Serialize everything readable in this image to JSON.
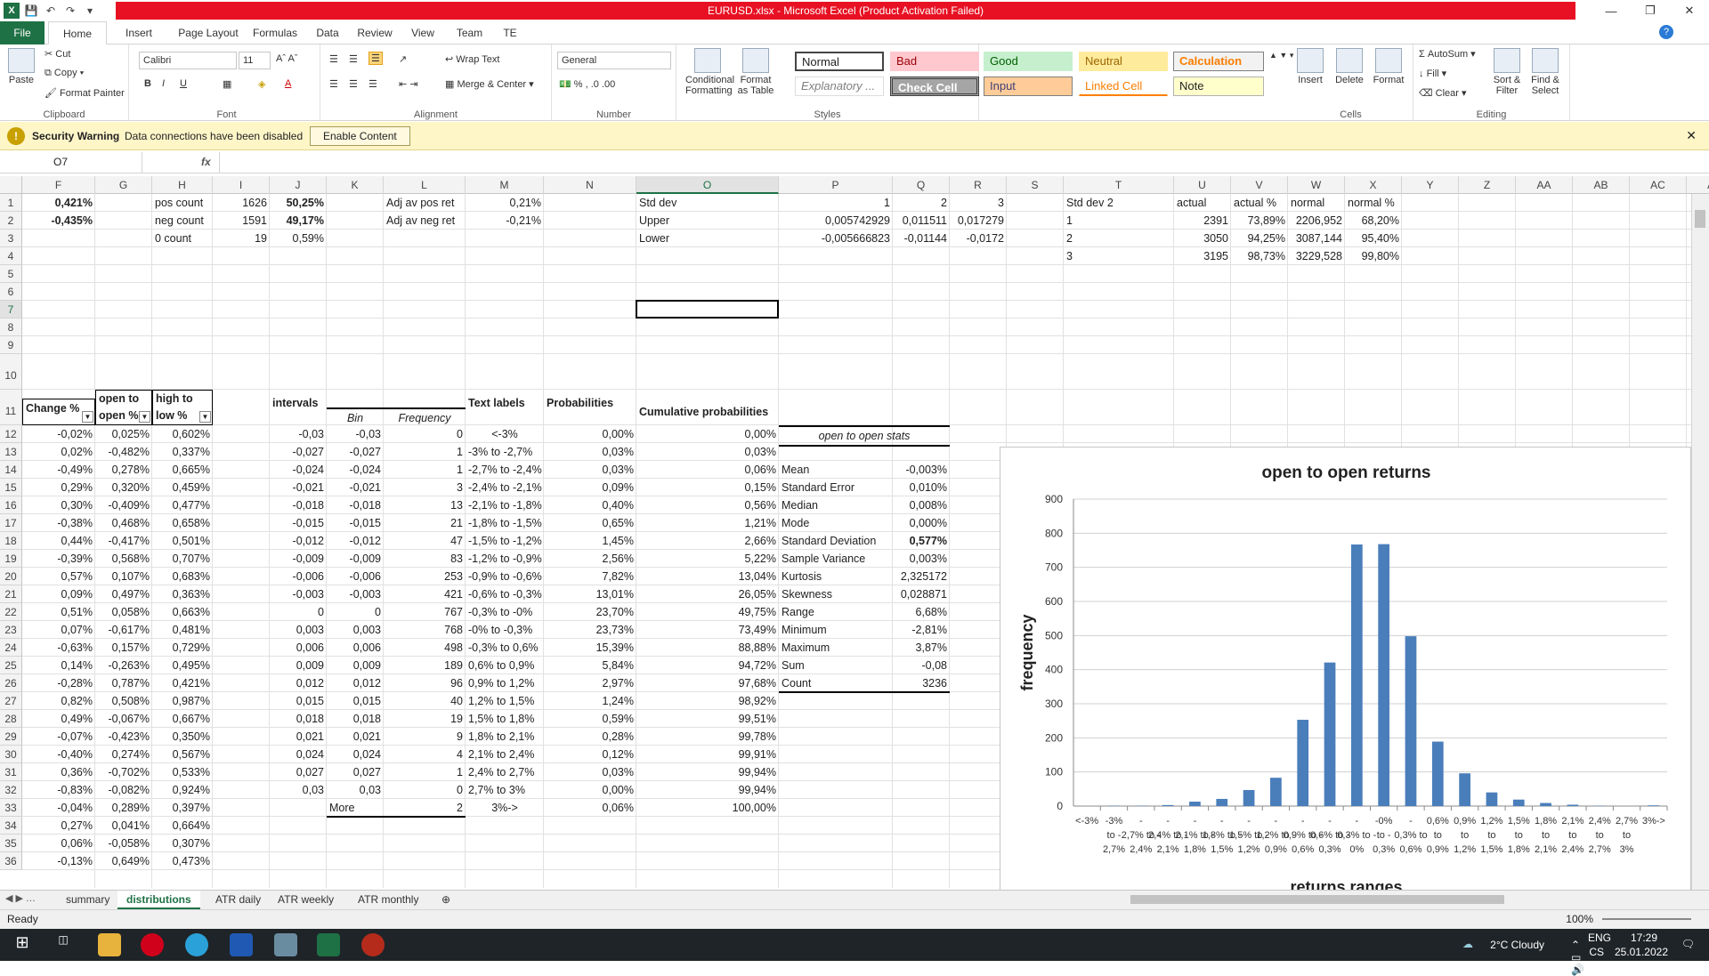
{
  "window": {
    "title": "EURUSD.xlsx  -  Microsoft Excel (Product Activation Failed)"
  },
  "ribbon": {
    "tabs": [
      "File",
      "Home",
      "Insert",
      "Page Layout",
      "Formulas",
      "Data",
      "Review",
      "View",
      "Team",
      "TE"
    ],
    "clipboard": {
      "paste": "Paste",
      "cut": "Cut",
      "copy": "Copy",
      "format_painter": "Format Painter",
      "label": "Clipboard"
    },
    "font": {
      "name": "Calibri",
      "size": "11",
      "label": "Font"
    },
    "alignment": {
      "wrap": "Wrap Text",
      "merge": "Merge & Center",
      "label": "Alignment"
    },
    "number": {
      "format": "General",
      "label": "Number"
    },
    "styles": {
      "cond": "Conditional Formatting",
      "fmt_table": "Format as Table",
      "label": "Styles",
      "boxes": [
        "Normal",
        "Bad",
        "Good",
        "Neutral",
        "Calculation",
        "Explanatory ...",
        "Check Cell",
        "Input",
        "Linked Cell",
        "Note"
      ]
    },
    "cells": {
      "insert": "Insert",
      "delete": "Delete",
      "format": "Format",
      "label": "Cells"
    },
    "editing": {
      "autosum": "AutoSum",
      "fill": "Fill",
      "clear": "Clear",
      "sort": "Sort & Filter",
      "find": "Find & Select",
      "label": "Editing"
    }
  },
  "security": {
    "label": "Security Warning",
    "message": "Data connections have been disabled",
    "button": "Enable Content"
  },
  "formula_bar": {
    "name_box": "O7",
    "fx": "fx"
  },
  "columns": [
    "F",
    "G",
    "H",
    "I",
    "J",
    "K",
    "L",
    "M",
    "N",
    "O",
    "P",
    "Q",
    "R",
    "S",
    "T",
    "U",
    "V",
    "W",
    "X",
    "Y",
    "Z",
    "AA",
    "AB",
    "AC",
    "AD"
  ],
  "rows": [
    "1",
    "2",
    "3",
    "4",
    "5",
    "6",
    "7",
    "8",
    "9",
    "10",
    "11",
    "12",
    "13",
    "14",
    "15",
    "16",
    "17",
    "18",
    "19",
    "20",
    "21",
    "22",
    "23",
    "24",
    "25",
    "26",
    "27",
    "28",
    "29",
    "30",
    "31",
    "32",
    "33",
    "34",
    "35",
    "36"
  ],
  "top": {
    "f1": "0,421%",
    "f2": "-0,435%",
    "h1": "pos count",
    "h2": "neg count",
    "h3": "0 count",
    "i1": "1626",
    "i2": "1591",
    "i3": "19",
    "j1": "50,25%",
    "j2": "49,17%",
    "j3": "0,59%",
    "l1": "Adj av pos ret",
    "l2": "Adj av neg ret",
    "m1": "0,21%",
    "m2": "-0,21%",
    "o1": "Std dev",
    "o2": "Upper",
    "o3": "Lower",
    "p1": "1",
    "p2": "0,005742929",
    "p3": "-0,005666823",
    "q1": "2",
    "q2": "0,011511",
    "q3": "-0,01144",
    "r1": "3",
    "r2": "0,017279",
    "r3": "-0,0172",
    "t1": "Std dev 2",
    "t2": "1",
    "t3": "2",
    "t4": "3",
    "u1": "actual",
    "u2": "2391",
    "u3": "3050",
    "u4": "3195",
    "v1": "actual %",
    "v2": "73,89%",
    "v3": "94,25%",
    "v4": "98,73%",
    "w1": "normal",
    "w2": "2206,952",
    "w3": "3087,144",
    "w4": "3229,528",
    "x1": "normal %",
    "x2": "68,20%",
    "x3": "95,40%",
    "x4": "99,80%"
  },
  "headers11": {
    "f": "Change %",
    "g": "open to open %",
    "h": "high to low %",
    "j": "intervals",
    "k": "Bin",
    "l": "Frequency",
    "m": "Text labels",
    "n": "Probabilities",
    "o": "Cumulative probabilities"
  },
  "table": [
    [
      "-0,02%",
      "0,025%",
      "0,602%",
      "-0,03",
      "-0,03",
      "0",
      "<-3%",
      "0,00%",
      "0,00%"
    ],
    [
      "0,02%",
      "-0,482%",
      "0,337%",
      "-0,027",
      "-0,027",
      "1",
      "-3% to -2,7%",
      "0,03%",
      "0,03%"
    ],
    [
      "-0,49%",
      "0,278%",
      "0,665%",
      "-0,024",
      "-0,024",
      "1",
      "-2,7% to -2,4%",
      "0,03%",
      "0,06%"
    ],
    [
      "0,29%",
      "0,320%",
      "0,459%",
      "-0,021",
      "-0,021",
      "3",
      "-2,4% to -2,1%",
      "0,09%",
      "0,15%"
    ],
    [
      "0,30%",
      "-0,409%",
      "0,477%",
      "-0,018",
      "-0,018",
      "13",
      "-2,1% to -1,8%",
      "0,40%",
      "0,56%"
    ],
    [
      "-0,38%",
      "0,468%",
      "0,658%",
      "-0,015",
      "-0,015",
      "21",
      "-1,8% to -1,5%",
      "0,65%",
      "1,21%"
    ],
    [
      "0,44%",
      "-0,417%",
      "0,501%",
      "-0,012",
      "-0,012",
      "47",
      "-1,5% to -1,2%",
      "1,45%",
      "2,66%"
    ],
    [
      "-0,39%",
      "0,568%",
      "0,707%",
      "-0,009",
      "-0,009",
      "83",
      "-1,2% to -0,9%",
      "2,56%",
      "5,22%"
    ],
    [
      "0,57%",
      "0,107%",
      "0,683%",
      "-0,006",
      "-0,006",
      "253",
      "-0,9% to -0,6%",
      "7,82%",
      "13,04%"
    ],
    [
      "0,09%",
      "0,497%",
      "0,363%",
      "-0,003",
      "-0,003",
      "421",
      "-0,6% to -0,3%",
      "13,01%",
      "26,05%"
    ],
    [
      "0,51%",
      "0,058%",
      "0,663%",
      "0",
      "0",
      "767",
      "-0,3% to -0%",
      "23,70%",
      "49,75%"
    ],
    [
      "0,07%",
      "-0,617%",
      "0,481%",
      "0,003",
      "0,003",
      "768",
      "-0% to -0,3%",
      "23,73%",
      "73,49%"
    ],
    [
      "-0,63%",
      "0,157%",
      "0,729%",
      "0,006",
      "0,006",
      "498",
      "-0,3% to 0,6%",
      "15,39%",
      "88,88%"
    ],
    [
      "0,14%",
      "-0,263%",
      "0,495%",
      "0,009",
      "0,009",
      "189",
      "0,6% to 0,9%",
      "5,84%",
      "94,72%"
    ],
    [
      "-0,28%",
      "0,787%",
      "0,421%",
      "0,012",
      "0,012",
      "96",
      "0,9% to 1,2%",
      "2,97%",
      "97,68%"
    ],
    [
      "0,82%",
      "0,508%",
      "0,987%",
      "0,015",
      "0,015",
      "40",
      "1,2% to 1,5%",
      "1,24%",
      "98,92%"
    ],
    [
      "0,49%",
      "-0,067%",
      "0,667%",
      "0,018",
      "0,018",
      "19",
      "1,5% to 1,8%",
      "0,59%",
      "99,51%"
    ],
    [
      "-0,07%",
      "-0,423%",
      "0,350%",
      "0,021",
      "0,021",
      "9",
      "1,8% to 2,1%",
      "0,28%",
      "99,78%"
    ],
    [
      "-0,40%",
      "0,274%",
      "0,567%",
      "0,024",
      "0,024",
      "4",
      "2,1% to 2,4%",
      "0,12%",
      "99,91%"
    ],
    [
      "0,36%",
      "-0,702%",
      "0,533%",
      "0,027",
      "0,027",
      "1",
      "2,4% to 2,7%",
      "0,03%",
      "99,94%"
    ],
    [
      "-0,83%",
      "-0,082%",
      "0,924%",
      "0,03",
      "0,03",
      "0",
      "2,7% to 3%",
      "0,00%",
      "99,94%"
    ],
    [
      "-0,04%",
      "0,289%",
      "0,397%",
      "",
      "More",
      "2",
      "3%->",
      "0,06%",
      "100,00%"
    ],
    [
      "0,27%",
      "0,041%",
      "0,664%",
      "",
      "",
      "",
      "",
      "",
      ""
    ],
    [
      "0,06%",
      "-0,058%",
      "0,307%",
      "",
      "",
      "",
      "",
      "",
      ""
    ],
    [
      "-0,13%",
      "0,649%",
      "0,473%",
      "",
      "",
      "",
      "",
      "",
      ""
    ]
  ],
  "stats": {
    "title": "open to open stats",
    "rows": [
      [
        "Mean",
        "-0,003%"
      ],
      [
        "Standard Error",
        "0,010%"
      ],
      [
        "Median",
        "0,008%"
      ],
      [
        "Mode",
        "0,000%"
      ],
      [
        "Standard Deviation",
        "0,577%"
      ],
      [
        "Sample Variance",
        "0,003%"
      ],
      [
        "Kurtosis",
        "2,325172"
      ],
      [
        "Skewness",
        "0,028871"
      ],
      [
        "Range",
        "6,68%"
      ],
      [
        "Minimum",
        "-2,81%"
      ],
      [
        "Maximum",
        "3,87%"
      ],
      [
        "Sum",
        "-0,08"
      ],
      [
        "Count",
        "3236"
      ]
    ]
  },
  "chart_data": {
    "type": "bar",
    "title": "open to open returns",
    "xlabel": "returns ranges",
    "ylabel": "frequency",
    "ylim": [
      0,
      900
    ],
    "yticks": [
      "0",
      "100",
      "200",
      "300",
      "400",
      "500",
      "600",
      "700",
      "800",
      "900"
    ],
    "categories": [
      "<-3%",
      "-3% to -2,7%",
      "-2,7% to -2,4%",
      "-2,4% to -2,1%",
      "-2,1% to -1,8%",
      "-1,8% to -1,5%",
      "-1,5% to -1,2%",
      "-1,2% to -0,9%",
      "-0,9% to -0,6%",
      "-0,6% to -0,3%",
      "-0,3% to -0%",
      "-0% to -0,3%",
      "-0,3% to 0,6%",
      "0,6% to 0,9%",
      "0,9% to 1,2%",
      "1,2% to 1,5%",
      "1,5% to 1,8%",
      "1,8% to 2,1%",
      "2,1% to 2,4%",
      "2,4% to 2,7%",
      "2,7% to 3%",
      "3%->"
    ],
    "values": [
      0,
      1,
      1,
      3,
      13,
      21,
      47,
      83,
      253,
      421,
      767,
      768,
      498,
      189,
      96,
      40,
      19,
      9,
      4,
      1,
      0,
      2
    ],
    "tick_lines": [
      [
        "<-3%"
      ],
      [
        "-3%",
        "to -",
        "2,7%"
      ],
      [
        "-",
        "2,7% to -",
        "2,4%"
      ],
      [
        "-",
        "2,4% to -",
        "2,1%"
      ],
      [
        "-",
        "2,1% to -",
        "1,8%"
      ],
      [
        "-",
        "1,8% to -",
        "1,5%"
      ],
      [
        "-",
        "1,5% to -",
        "1,2%"
      ],
      [
        "-",
        "1,2% to -",
        "0,9%"
      ],
      [
        "-",
        "0,9% to -",
        "0,6%"
      ],
      [
        "-",
        "0,6% to -",
        "0,3%"
      ],
      [
        "-",
        "0,3% to -",
        "0%"
      ],
      [
        "-0%",
        "to -",
        "0,3%"
      ],
      [
        "-",
        "0,3% to",
        "0,6%"
      ],
      [
        "0,6%",
        "to",
        "0,9%"
      ],
      [
        "0,9%",
        "to",
        "1,2%"
      ],
      [
        "1,2%",
        "to",
        "1,5%"
      ],
      [
        "1,5%",
        "to",
        "1,8%"
      ],
      [
        "1,8%",
        "to",
        "2,1%"
      ],
      [
        "2,1%",
        "to",
        "2,4%"
      ],
      [
        "2,4%",
        "to",
        "2,7%"
      ],
      [
        "2,7%",
        "to",
        "3%"
      ],
      [
        "3%->"
      ]
    ],
    "grid": true,
    "bar_color": "#4a7ebb"
  },
  "sheets": [
    "summary",
    "distributions",
    "ATR daily",
    "ATR weekly",
    "ATR monthly"
  ],
  "status": {
    "ready": "Ready",
    "zoom": "100%"
  },
  "taskbar": {
    "weather": "2°C  Cloudy",
    "lang": "ENG",
    "lang2": "CS",
    "time": "17:29",
    "date": "25.01.2022"
  }
}
